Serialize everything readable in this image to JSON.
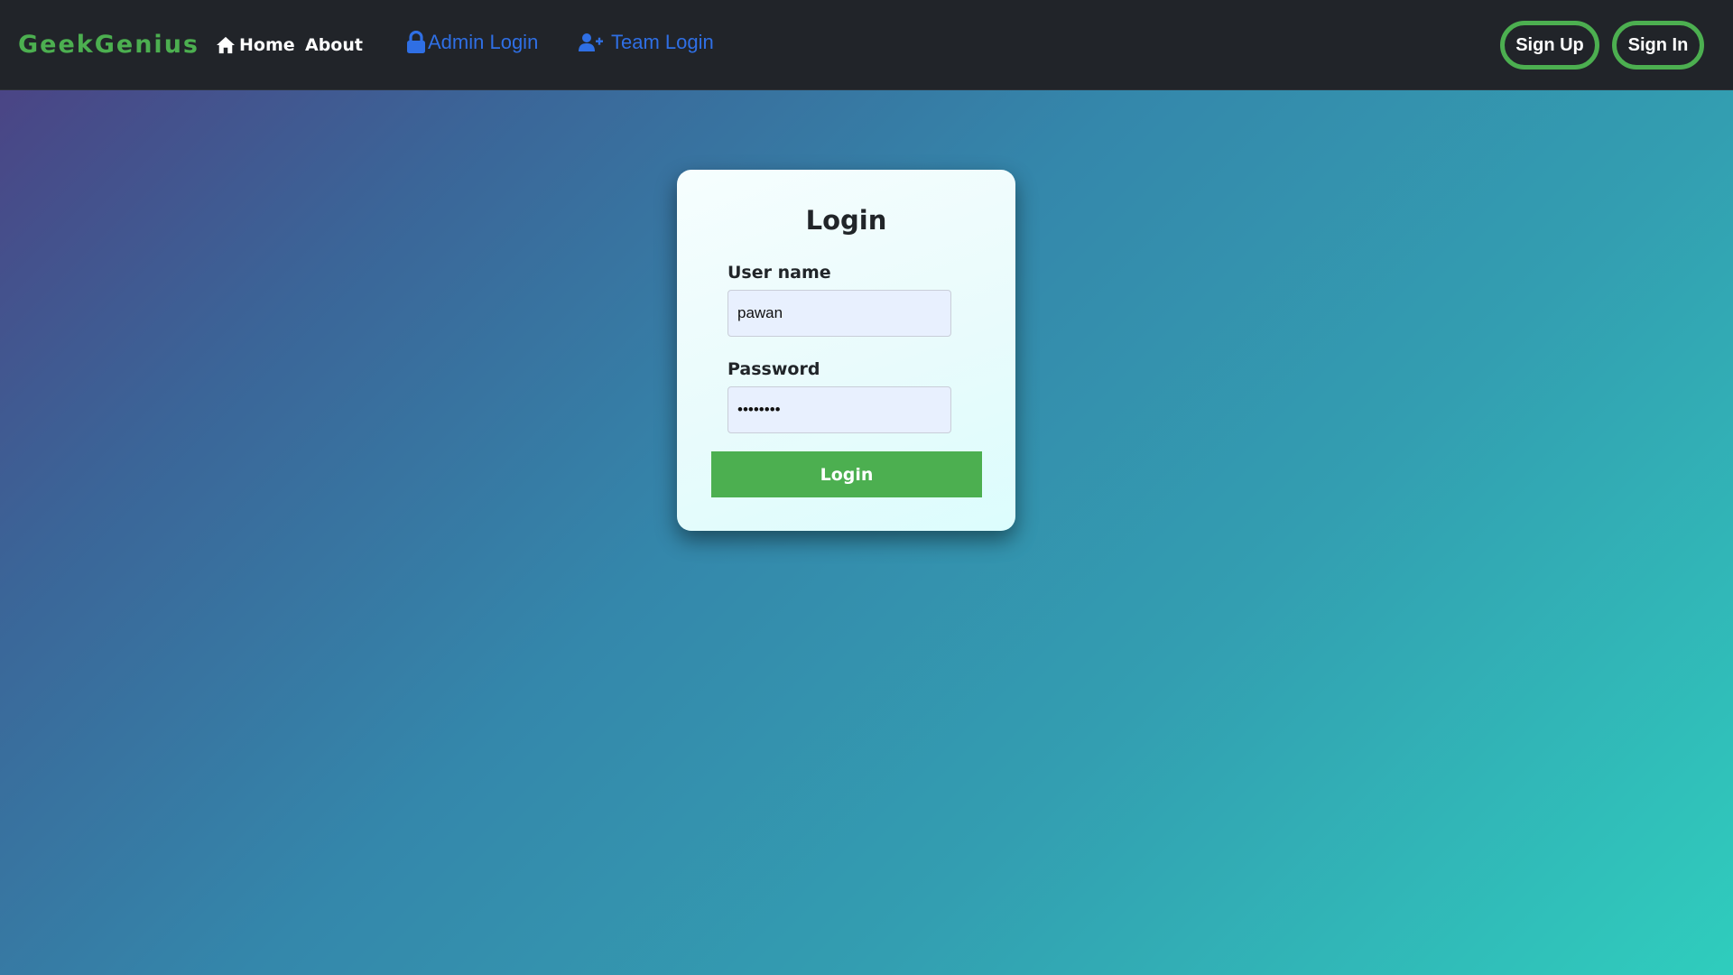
{
  "navbar": {
    "brand": "GeekGenius",
    "home_label": "Home",
    "home_icon": "home-icon",
    "about_label": "About",
    "admin_login_label": "Admin Login",
    "admin_login_icon": "lock-icon",
    "team_login_label": "Team Login",
    "team_login_icon": "user-plus-icon",
    "sign_up_label": "Sign Up",
    "sign_in_label": "Sign In"
  },
  "login_form": {
    "title": "Login",
    "username_label": "User name",
    "username_value": "pawan",
    "password_label": "Password",
    "password_value": "pawan123",
    "submit_label": "Login"
  },
  "colors": {
    "accent_green": "#4caf50",
    "link_blue": "#2f6fe4",
    "navbar_bg": "#212429"
  }
}
